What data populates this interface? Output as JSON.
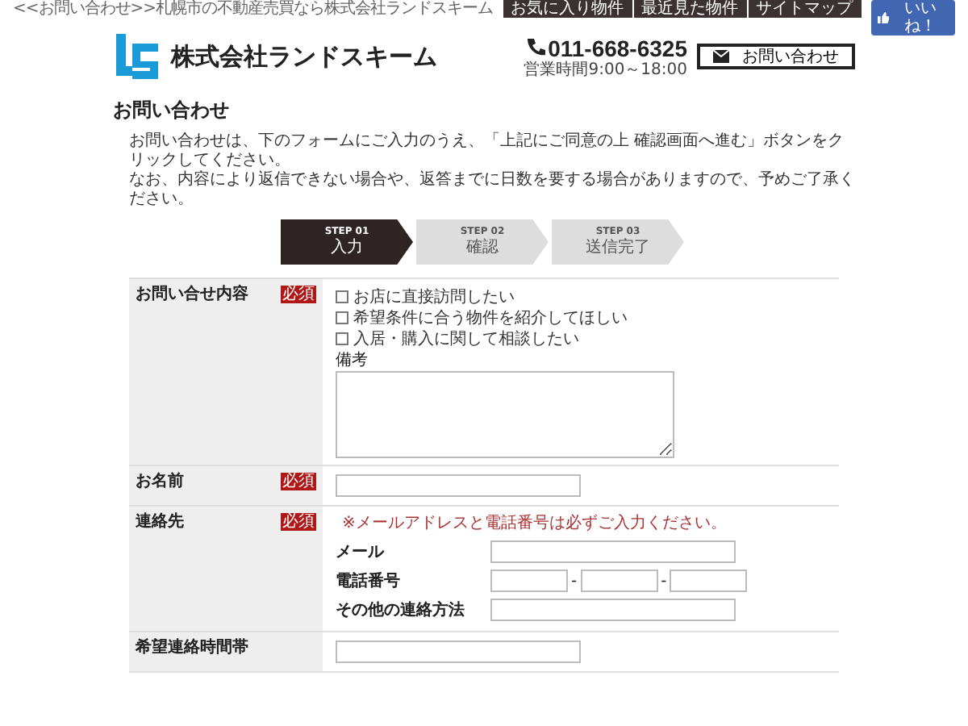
{
  "breadcrumb": "<<お問い合わせ>>札幌市の不動産売買なら株式会社ランドスキーム",
  "top_links": [
    "お気に入り物件",
    "最近見た物件",
    "サイトマップ"
  ],
  "like_button": "いいね！",
  "company": "株式会社ランドスキーム",
  "phone": "011-668-6325",
  "hours": "営業時間9:00～18:00",
  "contact_button": "お問い合わせ",
  "page_title": "お問い合わせ",
  "intro": [
    "お問い合わせは、下のフォームにご入力のうえ、「上記にご同意の上 確認画面へ進む」ボタンをクリックしてください。",
    "なお、内容により返信できない場合や、返答までに日数を要する場合がありますので、予めご了承ください。"
  ],
  "steps": [
    {
      "step": "STEP 01",
      "label": "入力",
      "selected": true
    },
    {
      "step": "STEP 02",
      "label": "確認",
      "selected": false
    },
    {
      "step": "STEP 03",
      "label": "送信完了",
      "selected": false
    }
  ],
  "form_rows": [
    {
      "label": "お問い合せ内容",
      "required": "必須",
      "kind": "inquiry",
      "options": [
        {
          "label": "お店に直接訪問したい",
          "checked": false
        },
        {
          "label": "希望条件に合う物件を紹介してほしい",
          "checked": false
        },
        {
          "label": "入居・購入に関して相談したい",
          "checked": false
        }
      ],
      "note_label": "備考"
    },
    {
      "label": "お名前",
      "required": "必須",
      "kind": "text"
    },
    {
      "label": "連絡先",
      "required": "必須",
      "kind": "contact",
      "notice": "※メールアドレスと電話番号は必ずご入力ください。",
      "fields": [
        {
          "label": "メール",
          "kind": "text"
        },
        {
          "label": "電話番号",
          "kind": "phone",
          "separators": [
            "-",
            "-"
          ]
        },
        {
          "label": "その他の連絡方法",
          "kind": "text"
        }
      ]
    },
    {
      "label": "希望連絡時間帯",
      "kind": "text"
    }
  ]
}
